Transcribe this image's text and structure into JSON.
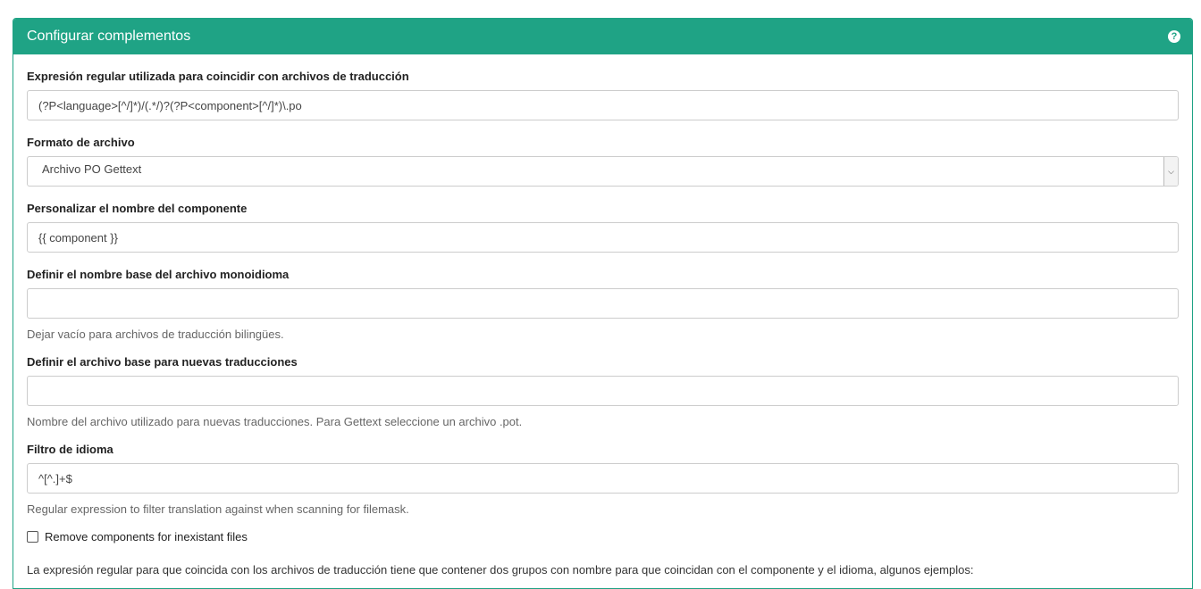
{
  "panel": {
    "title": "Configurar complementos",
    "help_icon": "question-circle-icon"
  },
  "fields": {
    "filemask": {
      "label": "Expresión regular utilizada para coincidir con archivos de traducción",
      "value": "(?P<language>[^/]*)/(.*/)?(?P<component>[^/]*)\\.po"
    },
    "file_format": {
      "label": "Formato de archivo",
      "value": "Archivo PO Gettext"
    },
    "name_template": {
      "label": "Personalizar el nombre del componente",
      "value": "{{ component }}"
    },
    "base_file_template": {
      "label": "Definir el nombre base del archivo monoidioma",
      "value": "",
      "help": "Dejar vacío para archivos de traducción bilingües."
    },
    "new_base_template": {
      "label": "Definir el archivo base para nuevas traducciones",
      "value": "",
      "help": "Nombre del archivo utilizado para nuevas traducciones. Para Gettext seleccione un archivo .pot."
    },
    "language_regex": {
      "label": "Filtro de idioma",
      "value": "^[^.]+$",
      "help": "Regular expression to filter translation against when scanning for filemask."
    },
    "remove_components": {
      "label": "Remove components for inexistant files",
      "checked": false
    }
  },
  "footer_text": "La expresión regular para que coincida con los archivos de traducción tiene que contener dos grupos con nombre para que coincidan con el componente y el idioma, algunos ejemplos:",
  "colors": {
    "accent": "#1fa385"
  }
}
